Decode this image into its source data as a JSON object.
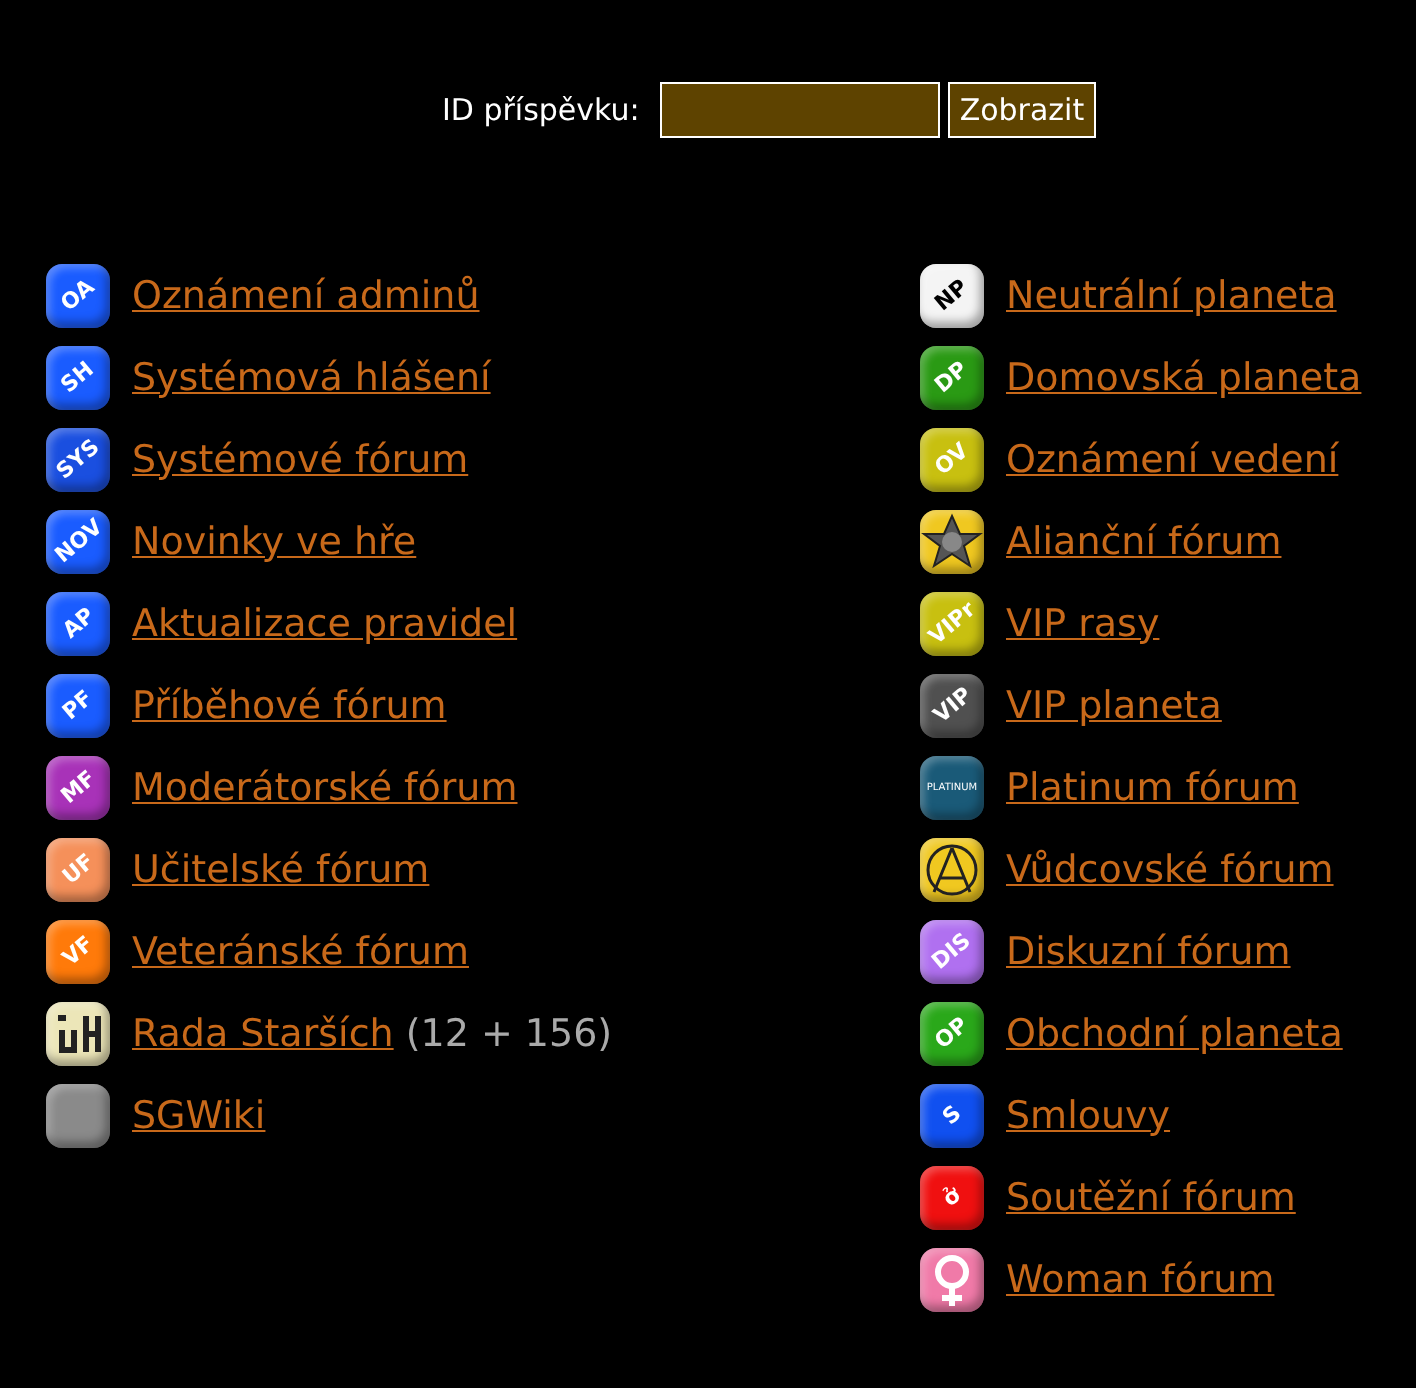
{
  "search": {
    "label": "ID příspěvku:",
    "button": "Zobrazit"
  },
  "columns": [
    [
      {
        "label": "Oznámení adminů",
        "kind": "text",
        "badge": "OA",
        "color": "#1a5cff"
      },
      {
        "label": "Systémová hlášení",
        "kind": "text",
        "badge": "SH",
        "color": "#1a5cff"
      },
      {
        "label": "Systémové fórum",
        "kind": "text",
        "badge": "SYS",
        "color": "#1a4fe0"
      },
      {
        "label": "Novinky ve hře",
        "kind": "text",
        "badge": "NOV",
        "color": "#1a5cff"
      },
      {
        "label": "Aktualizace pravidel",
        "kind": "text",
        "badge": "AP",
        "color": "#1a5cff"
      },
      {
        "label": "Příběhové fórum",
        "kind": "text",
        "badge": "PF",
        "color": "#1a5cff"
      },
      {
        "label": "Moderátorské fórum",
        "kind": "text",
        "badge": "MF",
        "color": "#a832b8"
      },
      {
        "label": "Učitelské fórum",
        "kind": "text",
        "badge": "UF",
        "color": "#f5905a"
      },
      {
        "label": "Veteránské fórum",
        "kind": "text",
        "badge": "VF",
        "color": "#ff7a0a"
      },
      {
        "label": "Rada Starších",
        "kind": "glyph",
        "color": "#ece6b8",
        "count": "(12 + 156)"
      },
      {
        "label": "SGWiki",
        "kind": "plain",
        "color": "#8a8a8a"
      }
    ],
    [
      {
        "label": "Neutrální planeta",
        "kind": "text",
        "badge": "NP",
        "color": "#f4f4f4"
      },
      {
        "label": "Domovská planeta",
        "kind": "text",
        "badge": "DP",
        "color": "#2a9a14"
      },
      {
        "label": "Oznámení vedení",
        "kind": "text",
        "badge": "OV",
        "color": "#c8c010"
      },
      {
        "label": "Alianční fórum",
        "kind": "star",
        "color": "#f0c820"
      },
      {
        "label": "VIP rasy",
        "kind": "text",
        "badge": "VIPr",
        "color": "#c8c010"
      },
      {
        "label": "VIP planeta",
        "kind": "text",
        "badge": "VIP",
        "color": "#505050"
      },
      {
        "label": "Platinum fórum",
        "kind": "text",
        "badge": "PLATINUM",
        "color": "#1a5a78"
      },
      {
        "label": "Vůdcovské fórum",
        "kind": "gate",
        "color": "#f0c820"
      },
      {
        "label": "Diskuzní fórum",
        "kind": "text",
        "badge": "DIS",
        "color": "#b070f0"
      },
      {
        "label": "Obchodní planeta",
        "kind": "text",
        "badge": "OP",
        "color": "#2aa81a"
      },
      {
        "label": "Smlouvy",
        "kind": "text",
        "badge": "S",
        "color": "#1050f0"
      },
      {
        "label": "Soutěžní fórum",
        "kind": "text",
        "badge": "ở",
        "color": "#f01010"
      },
      {
        "label": "Woman fórum",
        "kind": "female",
        "color": "#f07aa8"
      }
    ]
  ]
}
